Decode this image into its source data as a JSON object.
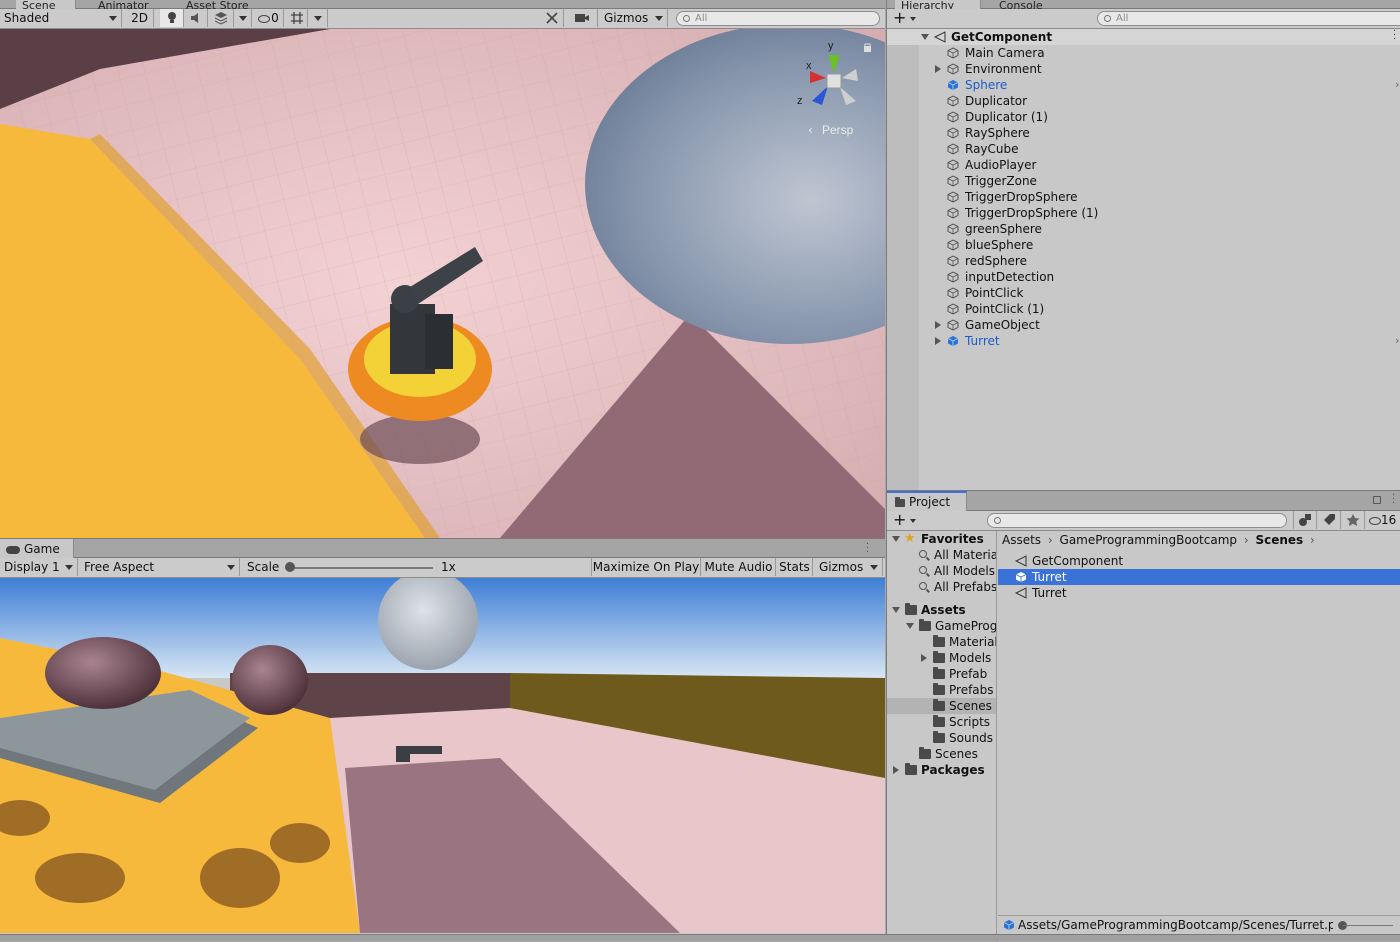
{
  "scene_panel": {
    "tabs": [
      "Scene",
      "Animator",
      "Asset Store"
    ],
    "shading_mode": "Shaded",
    "mode_2d": "2D",
    "hidden_count": "0",
    "gizmos_label": "Gizmos",
    "search_placeholder": "All",
    "gizmo_axes": {
      "y": "y",
      "x": "x",
      "z": "z"
    },
    "projection_label": "Persp"
  },
  "hierarchy_panel": {
    "tabs": [
      "Hierarchy",
      "Console"
    ],
    "search_placeholder": "All",
    "scene_name": "GetComponent",
    "items": [
      {
        "label": "Main Camera",
        "expandable": false,
        "selected_blue": false
      },
      {
        "label": "Environment",
        "expandable": true,
        "selected_blue": false
      },
      {
        "label": "Sphere",
        "expandable": false,
        "selected_blue": true
      },
      {
        "label": "Duplicator",
        "expandable": false,
        "selected_blue": false
      },
      {
        "label": "Duplicator (1)",
        "expandable": false,
        "selected_blue": false
      },
      {
        "label": "RaySphere",
        "expandable": false,
        "selected_blue": false
      },
      {
        "label": "RayCube",
        "expandable": false,
        "selected_blue": false
      },
      {
        "label": "AudioPlayer",
        "expandable": false,
        "selected_blue": false
      },
      {
        "label": "TriggerZone",
        "expandable": false,
        "selected_blue": false
      },
      {
        "label": "TriggerDropSphere",
        "expandable": false,
        "selected_blue": false
      },
      {
        "label": "TriggerDropSphere (1)",
        "expandable": false,
        "selected_blue": false
      },
      {
        "label": "greenSphere",
        "expandable": false,
        "selected_blue": false
      },
      {
        "label": "blueSphere",
        "expandable": false,
        "selected_blue": false
      },
      {
        "label": "redSphere",
        "expandable": false,
        "selected_blue": false
      },
      {
        "label": "inputDetection",
        "expandable": false,
        "selected_blue": false
      },
      {
        "label": "PointClick",
        "expandable": false,
        "selected_blue": false
      },
      {
        "label": "PointClick (1)",
        "expandable": false,
        "selected_blue": false
      },
      {
        "label": "GameObject",
        "expandable": true,
        "selected_blue": false
      },
      {
        "label": "Turret",
        "expandable": true,
        "selected_blue": true
      }
    ]
  },
  "game_panel": {
    "tab": "Game",
    "display": "Display 1",
    "aspect": "Free Aspect",
    "scale_label": "Scale",
    "scale_value": "1x",
    "buttons": [
      "Maximize On Play",
      "Mute Audio",
      "Stats",
      "Gizmos"
    ]
  },
  "project_panel": {
    "tab": "Project",
    "hidden_count": "16",
    "favorites": {
      "label": "Favorites",
      "items": [
        "All Materia",
        "All Models",
        "All Prefabs"
      ]
    },
    "tree": [
      {
        "label": "Assets",
        "depth": 0,
        "arrow": "down",
        "bold": true
      },
      {
        "label": "GameProgı",
        "depth": 1,
        "arrow": "down",
        "bold": false
      },
      {
        "label": "Material",
        "depth": 2,
        "arrow": "",
        "bold": false
      },
      {
        "label": "Models",
        "depth": 2,
        "arrow": "right",
        "bold": false
      },
      {
        "label": "Prefab",
        "depth": 2,
        "arrow": "",
        "bold": false
      },
      {
        "label": "Prefabs",
        "depth": 2,
        "arrow": "",
        "bold": false
      },
      {
        "label": "Scenes",
        "depth": 2,
        "arrow": "",
        "bold": false
      },
      {
        "label": "Scripts",
        "depth": 2,
        "arrow": "",
        "bold": false
      },
      {
        "label": "Sounds",
        "depth": 2,
        "arrow": "",
        "bold": false
      },
      {
        "label": "Scenes",
        "depth": 1,
        "arrow": "",
        "bold": false
      },
      {
        "label": "Packages",
        "depth": 0,
        "arrow": "right",
        "bold": true
      }
    ],
    "breadcrumb": [
      "Assets",
      "GameProgrammingBootcamp",
      "Scenes"
    ],
    "files": [
      {
        "label": "GetComponent",
        "kind": "scene",
        "selected": false
      },
      {
        "label": "Turret",
        "kind": "prefab",
        "selected": true
      },
      {
        "label": "Turret",
        "kind": "scene",
        "selected": false
      }
    ],
    "status_path": "Assets/GameProgrammingBootcamp/Scenes/Turret.prefa"
  },
  "colors": {
    "selection_blue": "#3a72d8",
    "link_blue": "#1a5fc6",
    "floor_pink": "#e7c3c6",
    "platform_yellow": "#f7b93c",
    "sphere_grey": "#8b9bb2"
  }
}
